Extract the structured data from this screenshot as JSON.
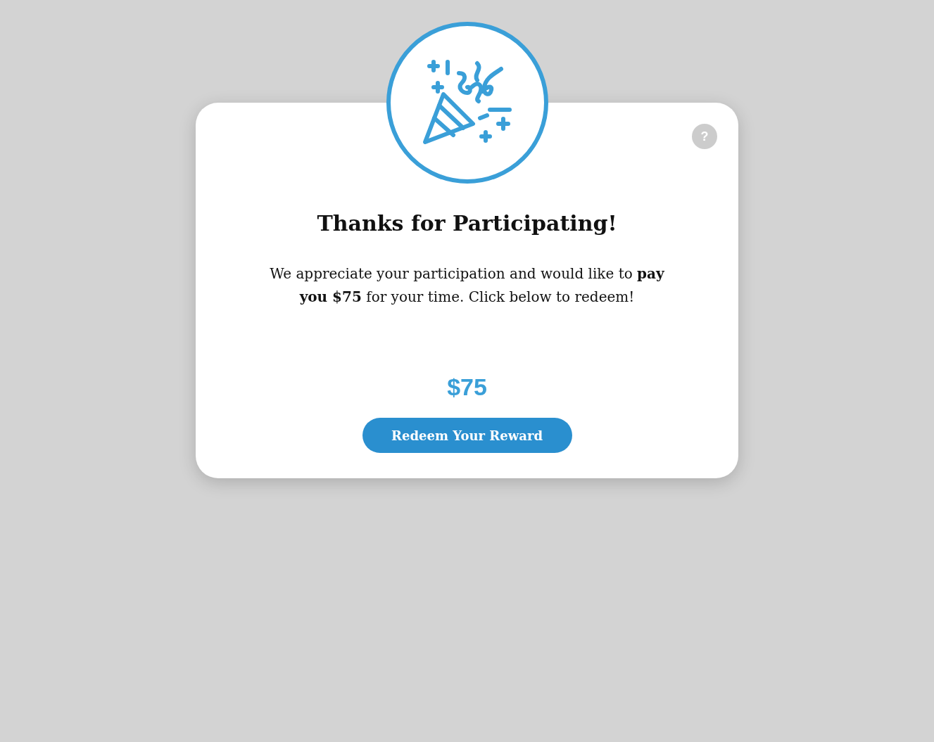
{
  "help": {
    "label": "?"
  },
  "title": "Thanks for Participating!",
  "message": "We appreciate your participation and would like to **pay you $75** for your time. Click below to redeem!",
  "amount": "$75",
  "button": {
    "label": "Redeem Your Reward"
  }
}
